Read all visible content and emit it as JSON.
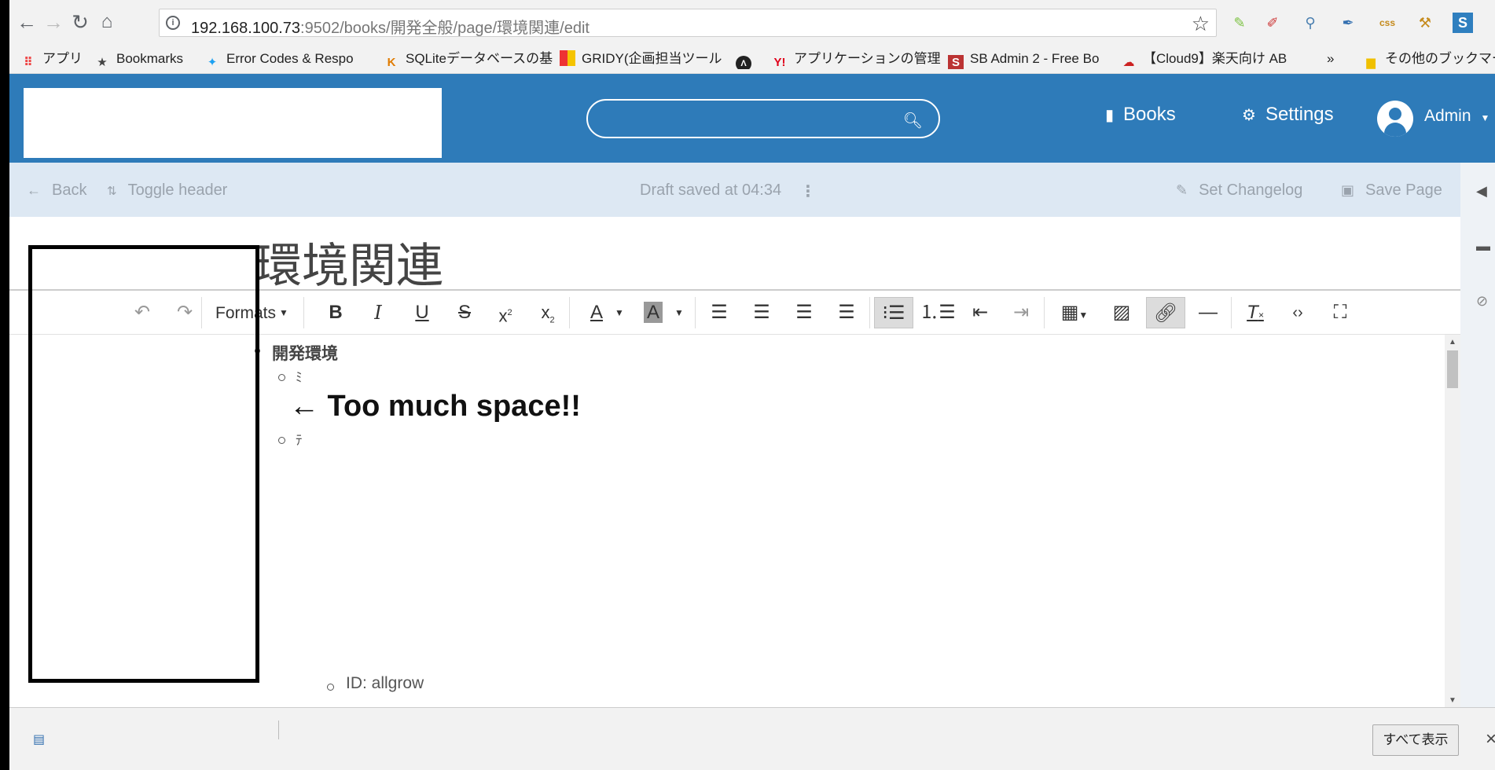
{
  "browser": {
    "url_host": "192.168.100.73",
    "url_rest": ":9502/books/開発全般/page/環境関連/edit",
    "bookmarks": [
      {
        "label": "アプリ",
        "icon": "apps-grid-icon"
      },
      {
        "label": "Bookmarks",
        "icon": "star-icon"
      },
      {
        "label": "Error Codes & Respo",
        "icon": "twitter-icon"
      },
      {
        "label": "SQLiteデータベースの基",
        "icon": "k-icon"
      },
      {
        "label": "GRIDY(企画担当ツール",
        "icon": "gridy-icon"
      },
      {
        "label": "",
        "icon": "arrow-logo-icon"
      },
      {
        "label": "アプリケーションの管理",
        "icon": "yahoo-icon"
      },
      {
        "label": "SB Admin 2 - Free Bo",
        "icon": "s-icon"
      },
      {
        "label": "【Cloud9】楽天向け AB",
        "icon": "cloud9-icon"
      },
      {
        "label": "その他のブックマーク",
        "icon": "folder-icon"
      }
    ],
    "overflow_label": "»"
  },
  "header": {
    "books_label": "Books",
    "settings_label": "Settings",
    "user_label": "Admin",
    "colors": {
      "header_bg": "#2e7bb9",
      "toolbar_bg": "#dde8f3"
    }
  },
  "page_toolbar": {
    "back_label": "Back",
    "toggle_header_label": "Toggle header",
    "draft_status": "Draft saved at 04:34",
    "set_changelog_label": "Set Changelog",
    "save_page_label": "Save Page"
  },
  "editor": {
    "title": "環境関連",
    "formats_label": "Formats",
    "content": {
      "heading": "開発環境",
      "sub_item_1": "ﾐ",
      "sub_item_2": "ﾃ",
      "annotation": "← Too much space!!",
      "nested_item": "ID: allgrow"
    }
  },
  "download_shelf": {
    "show_all_label": "すべて表示",
    "close_label": "×"
  }
}
